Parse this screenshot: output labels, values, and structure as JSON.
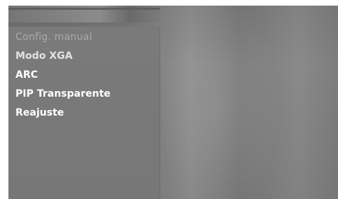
{
  "menu": {
    "items": [
      {
        "label": "Config. manual",
        "state": "disabled"
      },
      {
        "label": "Modo XGA",
        "state": "dim"
      },
      {
        "label": "ARC",
        "state": "enabled"
      },
      {
        "label": "PIP Transparente",
        "state": "enabled"
      },
      {
        "label": "Reajuste",
        "state": "enabled"
      }
    ]
  }
}
